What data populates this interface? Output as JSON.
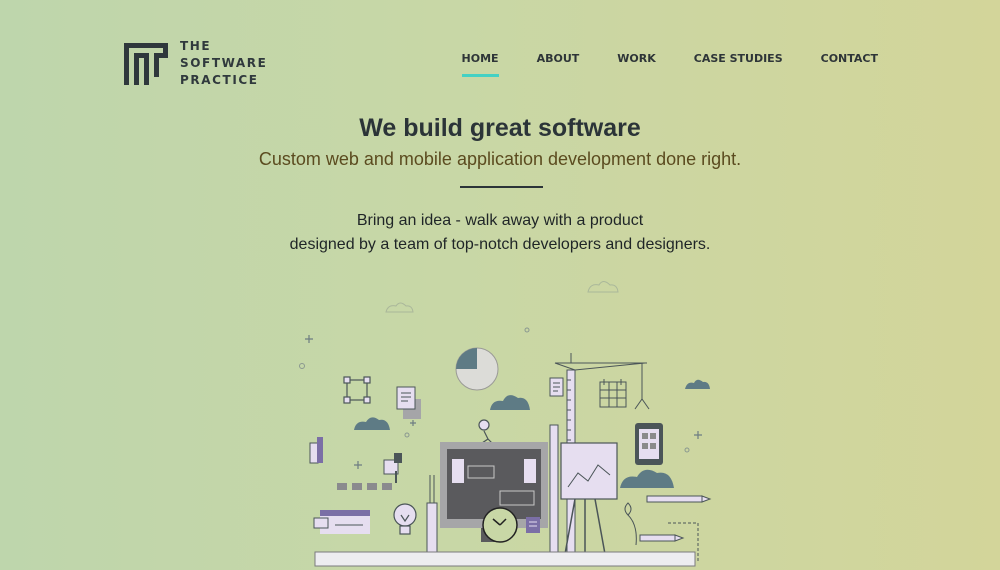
{
  "brand": {
    "line1": "THE",
    "line2": "SOFTWARE",
    "line3": "PRACTICE"
  },
  "nav": {
    "items": [
      {
        "label": "HOME",
        "active": true
      },
      {
        "label": "ABOUT",
        "active": false
      },
      {
        "label": "WORK",
        "active": false
      },
      {
        "label": "CASE STUDIES",
        "active": false
      },
      {
        "label": "CONTACT",
        "active": false
      }
    ],
    "active_color": "#44d1c4"
  },
  "hero": {
    "title": "We build great software",
    "subtitle": "Custom web and mobile application development done right.",
    "body_line1": "Bring an idea - walk away with a product",
    "body_line2": "designed by a team of top-notch developers and designers."
  },
  "colors": {
    "background_start": "#bed6ac",
    "background_end": "#d3d59a",
    "text_dark": "#2b3438",
    "subtitle": "#5b4b1f",
    "accent": "#44d1c4",
    "illustration_slate": "#5e7b85",
    "illustration_purple": "#7b6fa6",
    "illustration_lavender": "#e6def0"
  }
}
